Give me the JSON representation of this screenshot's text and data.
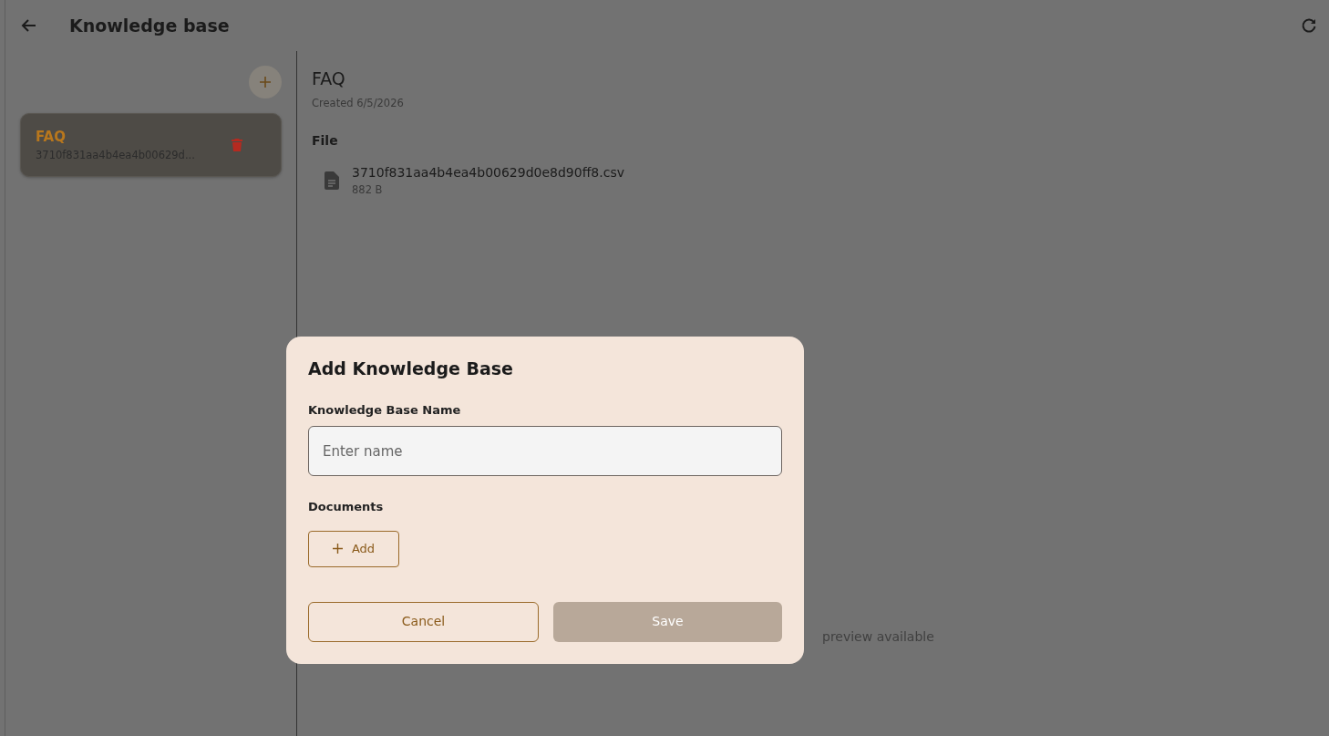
{
  "header": {
    "title": "Knowledge base"
  },
  "sidebar": {
    "items": [
      {
        "name": "FAQ",
        "subtitle": "3710f831aa4b4ea4b00629d...",
        "selected": true
      }
    ]
  },
  "detail": {
    "title": "FAQ",
    "created": "Created 6/5/2026",
    "file_heading": "File",
    "files": [
      {
        "name": "3710f831aa4b4ea4b00629d0e8d90ff8.csv",
        "size": "882 B"
      }
    ],
    "preview_note": "preview available"
  },
  "dialog": {
    "title": "Add Knowledge Base",
    "name_field": {
      "label": "Knowledge Base Name",
      "placeholder": "Enter name"
    },
    "documents_label": "Documents",
    "add_button": "Add",
    "buttons": [
      {
        "label": "Cancel",
        "kind": "outline",
        "disabled": false
      },
      {
        "label": "Save",
        "kind": "primary",
        "disabled": true
      }
    ]
  }
}
